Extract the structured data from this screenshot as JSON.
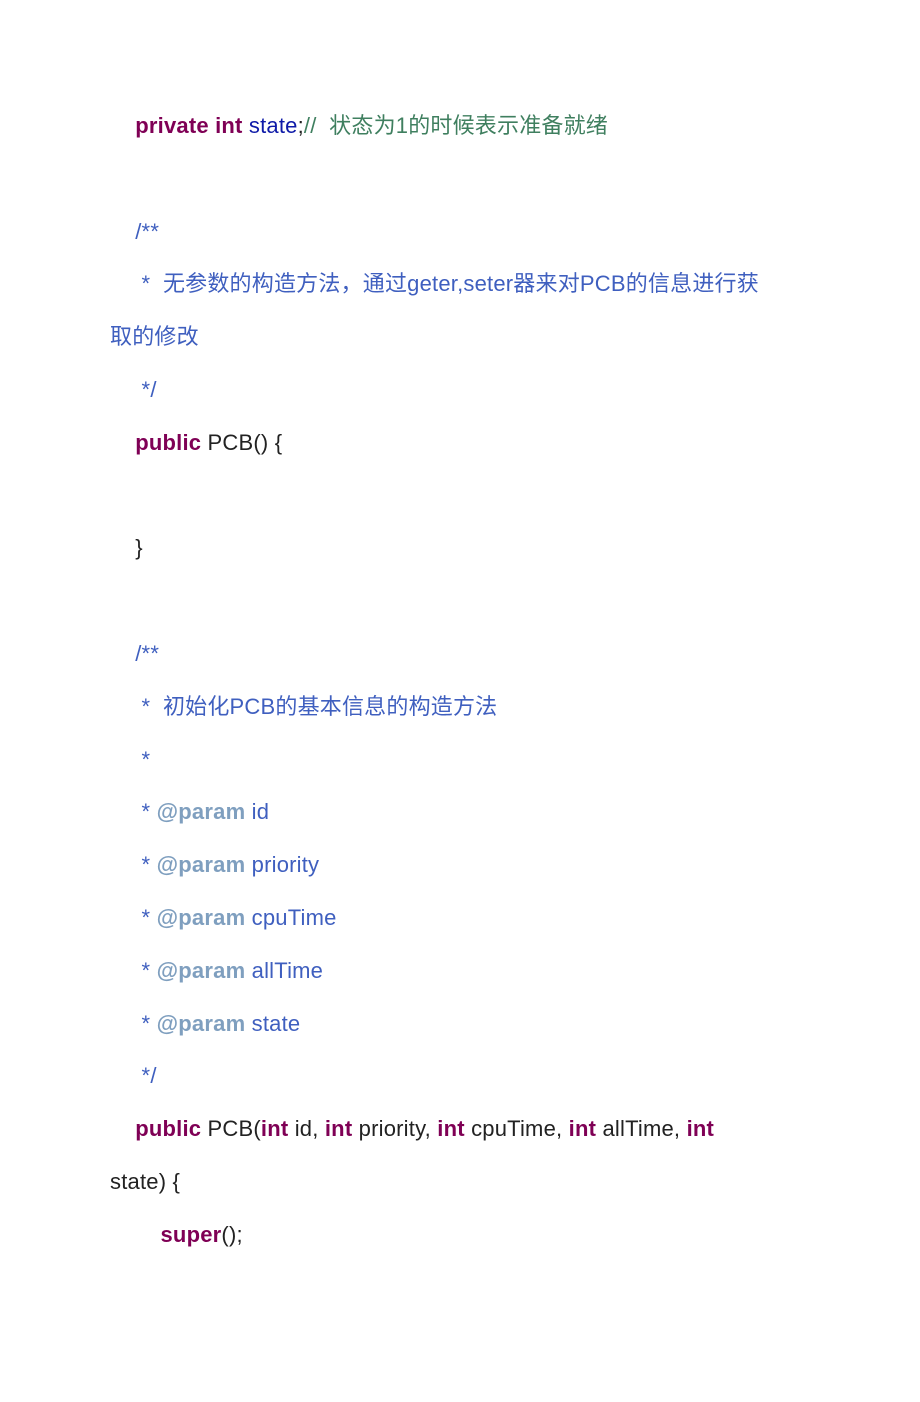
{
  "lines": {
    "l1_kw1": "private int",
    "l1_sp1": " ",
    "l1_var": "state",
    "l1_semi": ";",
    "l1_cmt": "//  状态为1的时候表示准备就绪",
    "blank": " ",
    "l3": "    /**",
    "l4": "     *  无参数的构造方法，通过geter,seter器来对PCB的信息进行获",
    "l4b": "取的修改",
    "l5": "     */",
    "l6_ind": "    ",
    "l6_kw": "public",
    "l6_rest": " PCB() {",
    "l8": "    }",
    "l10": "    /**",
    "l11": "     *  初始化PCB的基本信息的构造方法",
    "l12": "     *",
    "l13a": "     * ",
    "l13b": "@param",
    "l13c": " id",
    "l14c": " priority",
    "l15c": " cpuTime",
    "l16c": " allTime",
    "l17c": " state",
    "l18": "     */",
    "l19_ind": "    ",
    "l19_kw": "public",
    "l19_a": " PCB(",
    "l19_int": "int",
    "l19_b": " id, ",
    "l19_c": " priority, ",
    "l19_d": " cpuTime, ",
    "l19_e": " allTime, ",
    "l19_f": " ",
    "l20": "state) {",
    "l21_ind": "        ",
    "l21_kw": "super",
    "l21_rest": "();"
  }
}
